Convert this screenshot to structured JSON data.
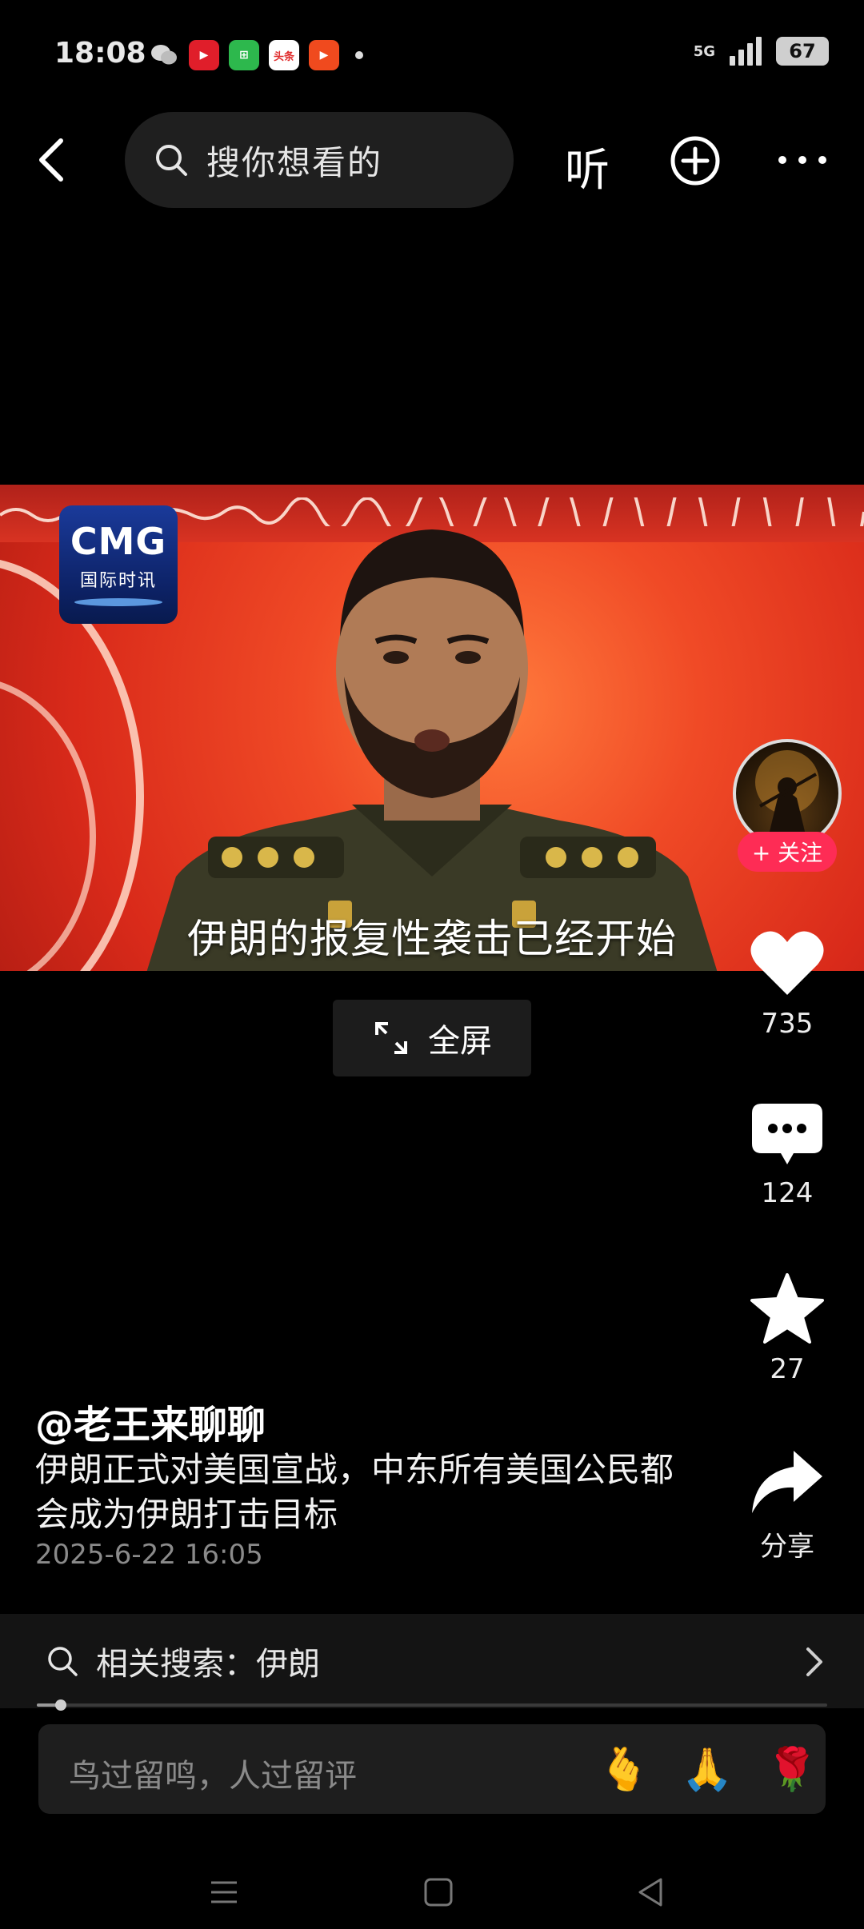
{
  "status_bar": {
    "time": "18:08",
    "apps": [
      {
        "name": "wechat-icon",
        "color": "#000000",
        "glyph": ""
      },
      {
        "name": "video-app-icon",
        "color": "#e01e2a",
        "glyph": "▶"
      },
      {
        "name": "green-app-icon",
        "color": "#2db84d",
        "glyph": "⊞"
      },
      {
        "name": "toutiao-icon",
        "color": "#e02b2b",
        "glyph": "头条"
      },
      {
        "name": "play-app-icon",
        "color": "#f04a1e",
        "glyph": "▶"
      }
    ],
    "network": "5G",
    "battery": "67"
  },
  "top_nav": {
    "search_placeholder": "搜你想看的",
    "listen_label": "听"
  },
  "video": {
    "logo_main": "CMG",
    "logo_sub": "国际时讯",
    "subtitle": "伊朗的报复性袭击已经开始"
  },
  "fullscreen": {
    "label": "全屏"
  },
  "rail": {
    "follow_label": "+ 关注",
    "likes": "735",
    "comments": "124",
    "favorites": "27",
    "share_label": "分享"
  },
  "post": {
    "author": "@老王来聊聊",
    "description": "伊朗正式对美国宣战，中东所有美国公民都会成为伊朗打击目标",
    "date": "2025-6-22 16:05"
  },
  "related_search": {
    "label": "相关搜索：伊朗"
  },
  "playback": {
    "progress_fraction": 0.03
  },
  "comment_input": {
    "placeholder": "鸟过留鸣，人过留评",
    "emojis": [
      "🫰",
      "🙏",
      "🌹"
    ]
  }
}
